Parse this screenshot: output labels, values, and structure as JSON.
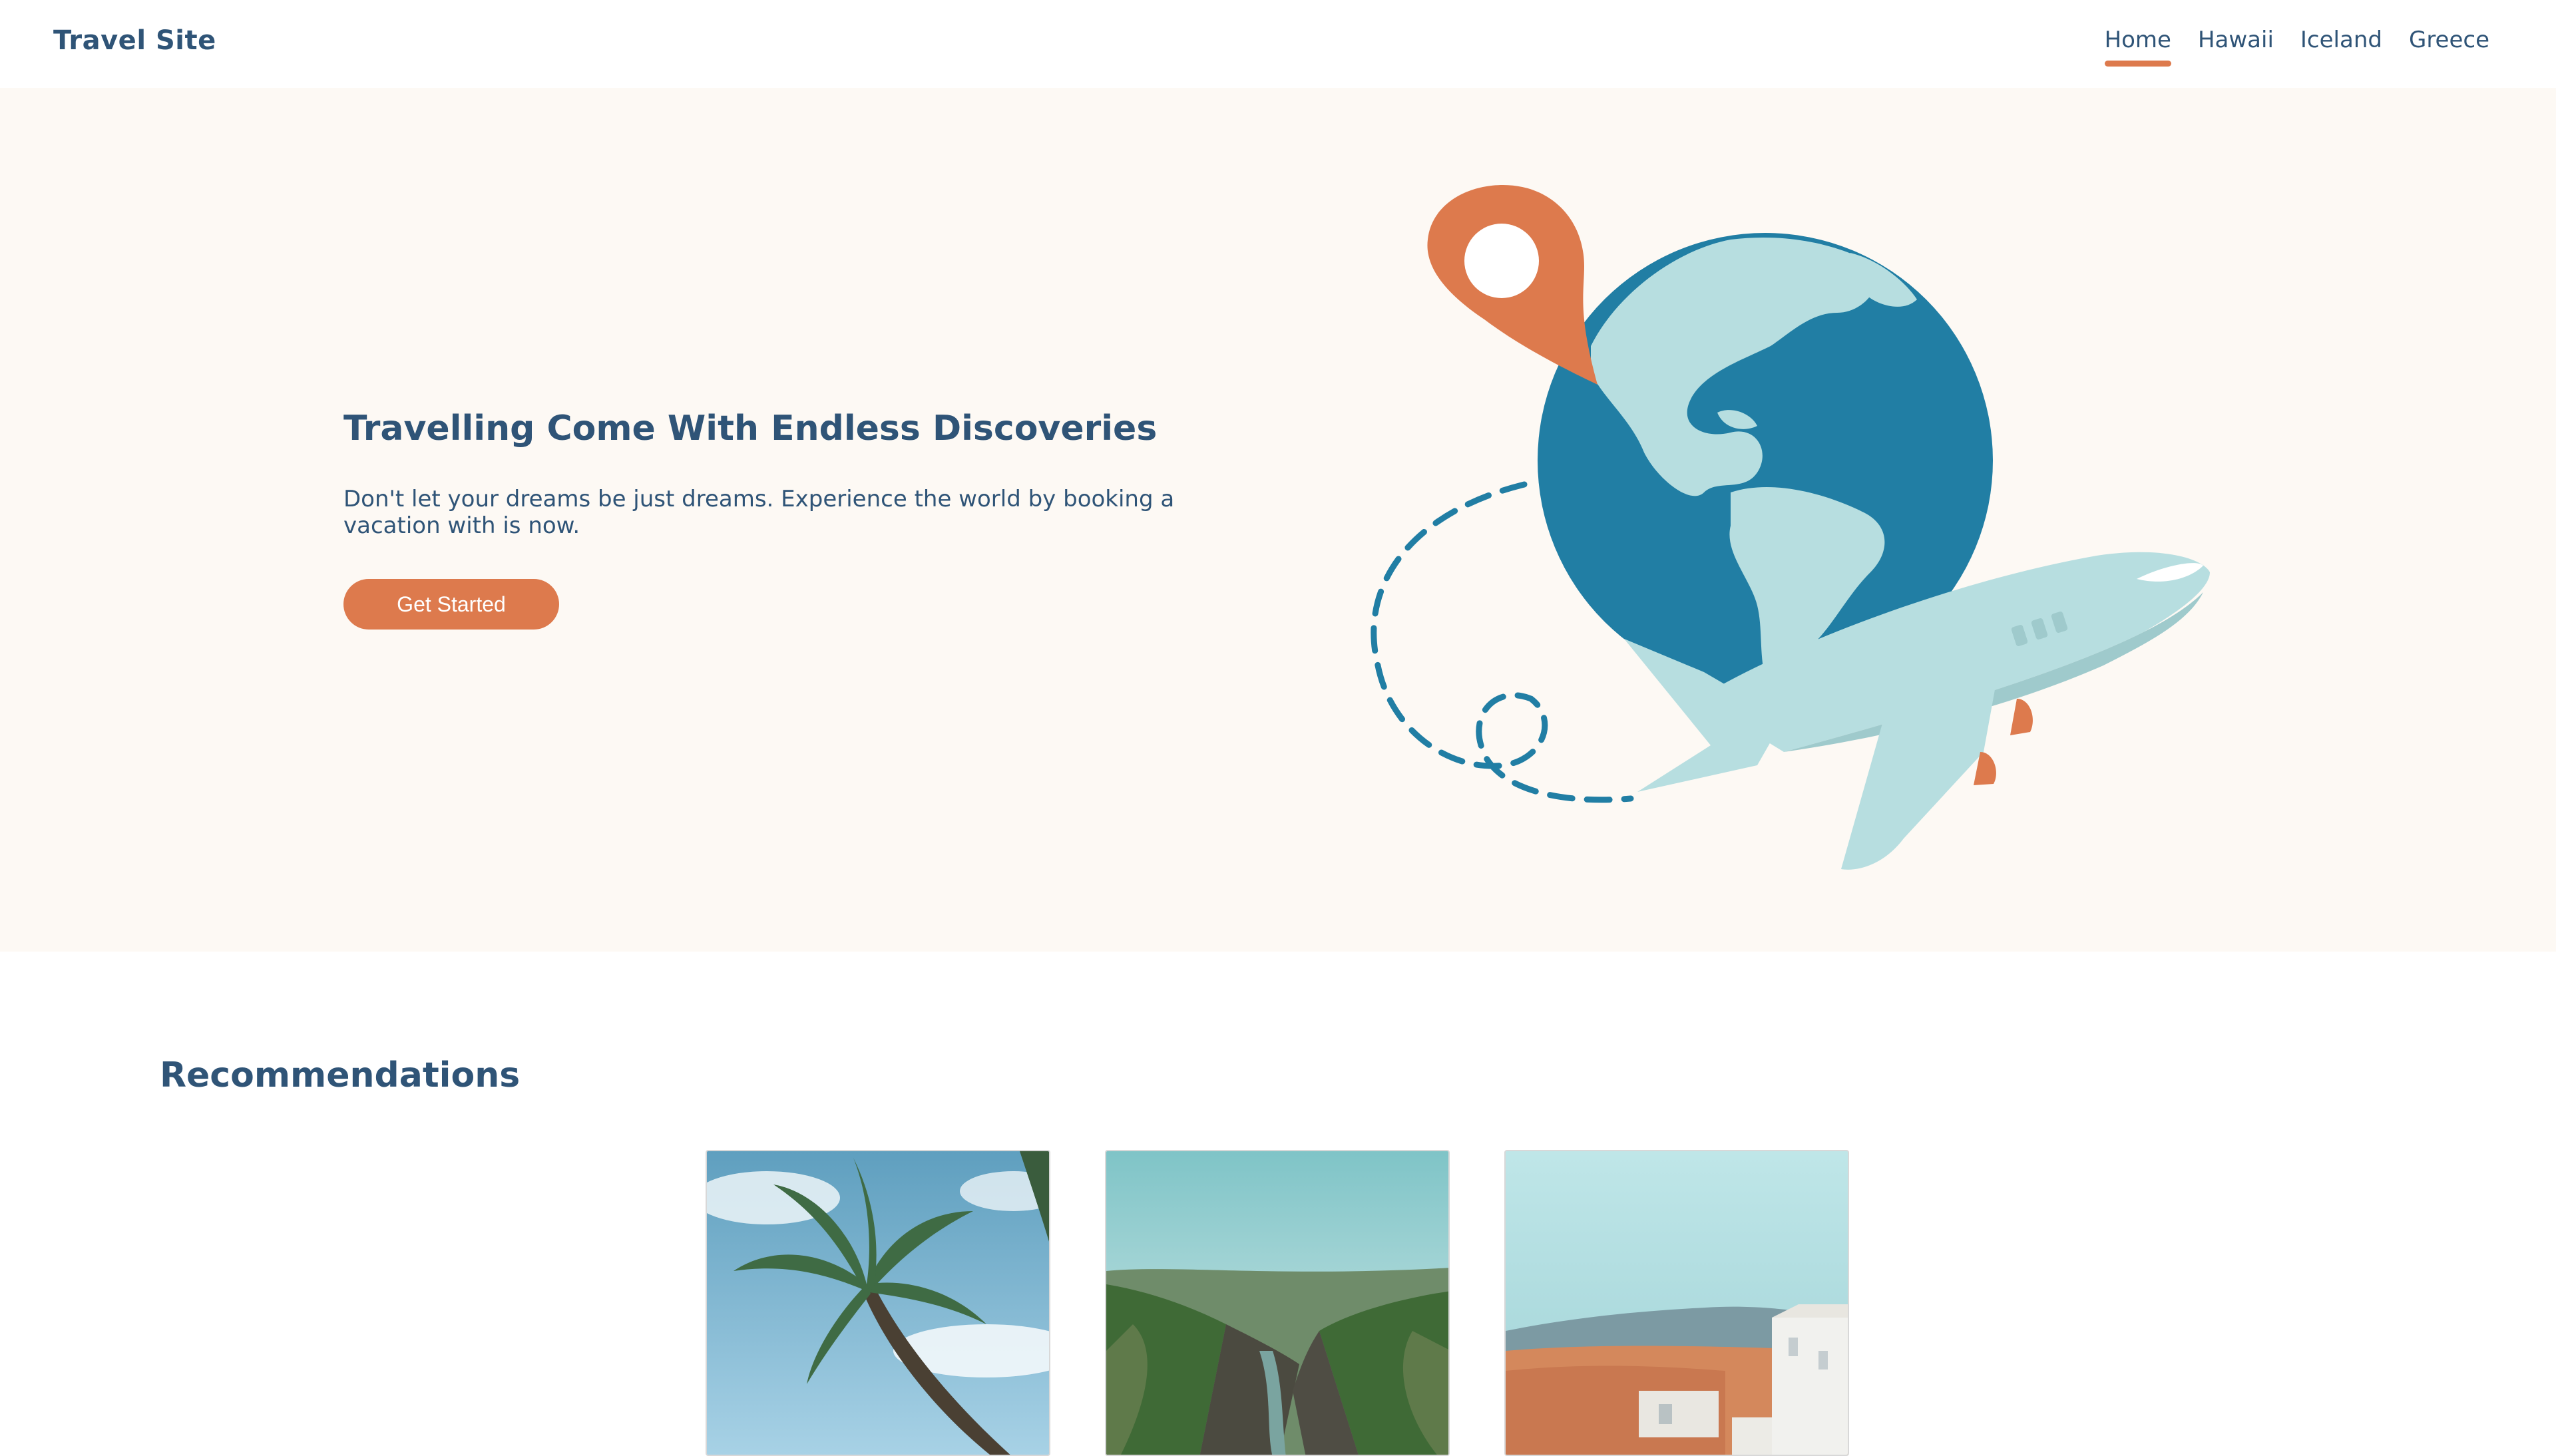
{
  "brand": {
    "logo": "Travel Site",
    "accent_color": "#dd7a4d",
    "primary_text_color": "#2f5477",
    "hero_background": "#fdf9f4"
  },
  "nav": {
    "items": [
      {
        "label": "Home",
        "active": true
      },
      {
        "label": "Hawaii",
        "active": false
      },
      {
        "label": "Iceland",
        "active": false
      },
      {
        "label": "Greece",
        "active": false
      }
    ]
  },
  "hero": {
    "title": "Travelling Come With Endless Discoveries",
    "text": "Don't let your dreams be just dreams. Experience the world by booking a vacation with is now.",
    "button_label": "Get Started",
    "illustration": "globe-map-pin-airplane-illustration"
  },
  "recommendations": {
    "title": "Recommendations",
    "cards": [
      {
        "image": "hawaii-palm-tree-photo"
      },
      {
        "image": "iceland-canyon-photo"
      },
      {
        "image": "greece-town-photo"
      }
    ]
  }
}
